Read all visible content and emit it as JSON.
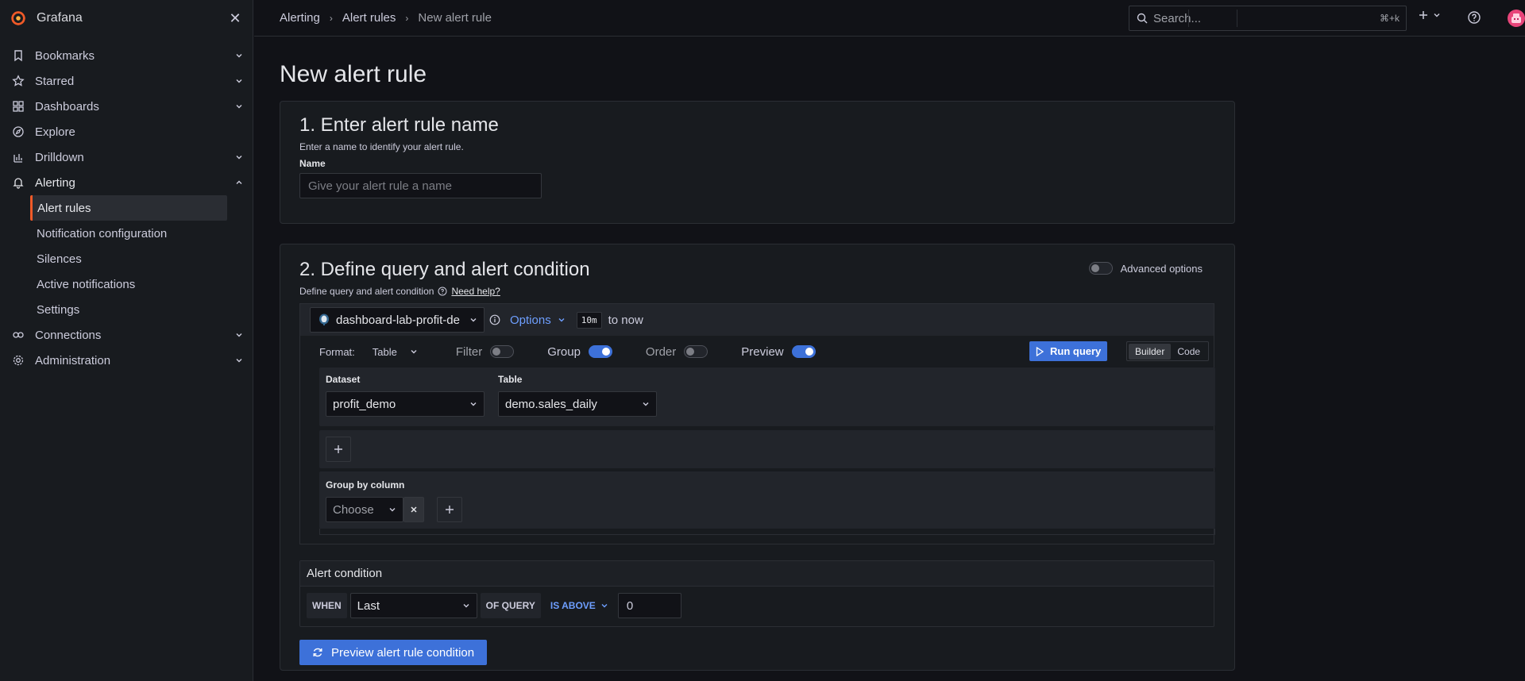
{
  "app": {
    "title": "Grafana"
  },
  "sidebar": {
    "items": [
      {
        "label": "Bookmarks",
        "icon": "bookmark-icon"
      },
      {
        "label": "Starred",
        "icon": "star-icon"
      },
      {
        "label": "Dashboards",
        "icon": "apps-icon"
      },
      {
        "label": "Explore",
        "icon": "compass-icon"
      },
      {
        "label": "Drilldown",
        "icon": "drilldown-icon"
      },
      {
        "label": "Alerting",
        "icon": "bell-icon"
      },
      {
        "label": "Connections",
        "icon": "connections-icon"
      },
      {
        "label": "Administration",
        "icon": "cog-icon"
      }
    ],
    "alerting_children": [
      {
        "label": "Alert rules",
        "active": true
      },
      {
        "label": "Notification configuration"
      },
      {
        "label": "Silences"
      },
      {
        "label": "Active notifications"
      },
      {
        "label": "Settings"
      }
    ]
  },
  "breadcrumb": [
    "Alerting",
    "Alert rules",
    "New alert rule"
  ],
  "search": {
    "placeholder": "Search...",
    "shortcut": "⌘+k"
  },
  "page": {
    "title": "New alert rule"
  },
  "section1": {
    "title": "1. Enter alert rule name",
    "subtitle": "Enter a name to identify your alert rule.",
    "name_label": "Name",
    "name_placeholder": "Give your alert rule a name"
  },
  "section2": {
    "title": "2. Define query and alert condition",
    "subtitle": "Define query and alert condition",
    "help_link": "Need help?",
    "advanced_label": "Advanced options",
    "datasource": "dashboard-lab-profit-de",
    "options_label": "Options",
    "time_badge": "10m",
    "time_suffix": "to now",
    "format_label": "Format:",
    "format_value": "Table",
    "filter_label": "Filter",
    "group_label": "Group",
    "order_label": "Order",
    "preview_label": "Preview",
    "run_query": "Run query",
    "mode_builder": "Builder",
    "mode_code": "Code",
    "dataset_label": "Dataset",
    "dataset_value": "profit_demo",
    "table_label": "Table",
    "table_value": "demo.sales_daily",
    "group_by_label": "Group by column",
    "group_by_placeholder": "Choose",
    "condition_title": "Alert condition",
    "when_kw": "WHEN",
    "reducer": "Last",
    "of_query_kw": "OF QUERY",
    "evaluator": "IS ABOVE",
    "threshold": "0",
    "preview_button": "Preview alert rule condition"
  },
  "colors": {
    "accent": "#3d71d9",
    "link": "#6e9fff",
    "active_marker": "#f05a28",
    "bg": "#111217",
    "panel": "#181b1f"
  }
}
